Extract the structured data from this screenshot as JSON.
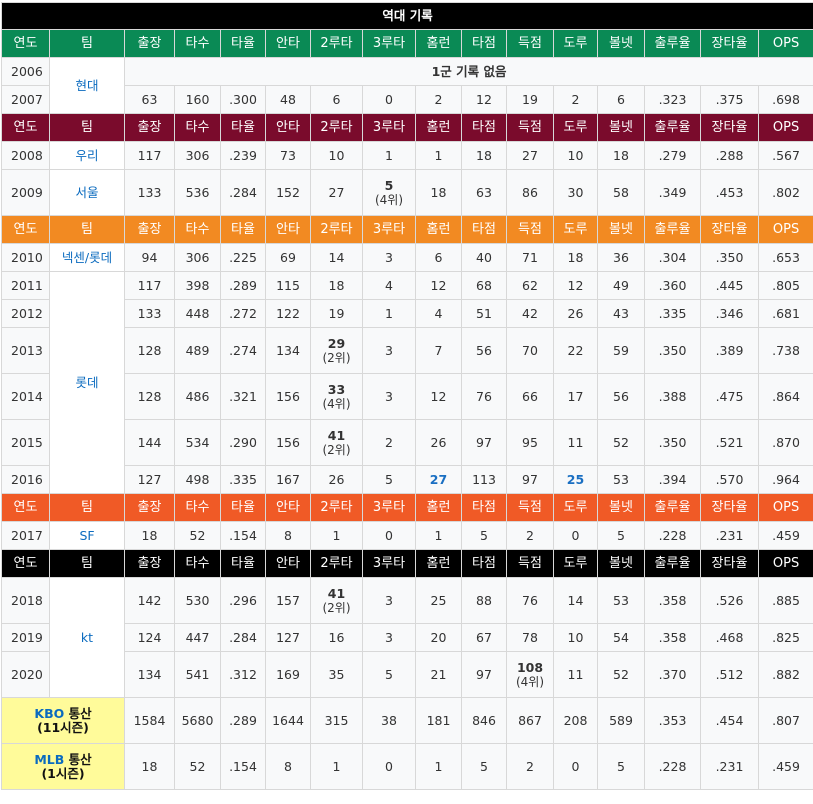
{
  "title": "역대 기록",
  "headers": [
    "연도",
    "팀",
    "출장",
    "타수",
    "타율",
    "안타",
    "2루타",
    "3루타",
    "홈런",
    "타점",
    "득점",
    "도루",
    "볼넷",
    "출루율",
    "장타율",
    "OPS"
  ],
  "no_record": "1군 기록 없음",
  "teams": {
    "hyundai": "현대",
    "woori": "우리",
    "seoul": "서울",
    "nexen_lotte": "넥센/롯데",
    "lotte": "롯데",
    "sf": "SF",
    "kt": "kt"
  },
  "rows": [
    {
      "year": "2006"
    },
    {
      "year": "2007",
      "v": [
        "63",
        "160",
        ".300",
        "48",
        "6",
        "0",
        "2",
        "12",
        "19",
        "2",
        "6",
        ".323",
        ".375",
        ".698"
      ]
    },
    {
      "year": "2008",
      "v": [
        "117",
        "306",
        ".239",
        "73",
        "10",
        "1",
        "1",
        "18",
        "27",
        "10",
        "18",
        ".279",
        ".288",
        ".567"
      ]
    },
    {
      "year": "2009",
      "v": [
        "133",
        "536",
        ".284",
        "152",
        "27",
        "5",
        "18",
        "63",
        "86",
        "30",
        "58",
        ".349",
        ".453",
        ".802"
      ],
      "rank": "(4위)"
    },
    {
      "year": "2010",
      "v": [
        "94",
        "306",
        ".225",
        "69",
        "14",
        "3",
        "6",
        "40",
        "71",
        "18",
        "36",
        ".304",
        ".350",
        ".653"
      ]
    },
    {
      "year": "2011",
      "v": [
        "117",
        "398",
        ".289",
        "115",
        "18",
        "4",
        "12",
        "68",
        "62",
        "12",
        "49",
        ".360",
        ".445",
        ".805"
      ]
    },
    {
      "year": "2012",
      "v": [
        "133",
        "448",
        ".272",
        "122",
        "19",
        "1",
        "4",
        "51",
        "42",
        "26",
        "43",
        ".335",
        ".346",
        ".681"
      ]
    },
    {
      "year": "2013",
      "v": [
        "128",
        "489",
        ".274",
        "134",
        "29",
        "3",
        "7",
        "56",
        "70",
        "22",
        "59",
        ".350",
        ".389",
        ".738"
      ],
      "rank": "(2위)"
    },
    {
      "year": "2014",
      "v": [
        "128",
        "486",
        ".321",
        "156",
        "33",
        "3",
        "12",
        "76",
        "66",
        "17",
        "56",
        ".388",
        ".475",
        ".864"
      ],
      "rank": "(4위)"
    },
    {
      "year": "2015",
      "v": [
        "144",
        "534",
        ".290",
        "156",
        "41",
        "2",
        "26",
        "97",
        "95",
        "11",
        "52",
        ".350",
        ".521",
        ".870"
      ],
      "rank": "(2위)"
    },
    {
      "year": "2016",
      "v": [
        "127",
        "498",
        ".335",
        "167",
        "26",
        "5",
        "27",
        "113",
        "97",
        "25",
        "53",
        ".394",
        ".570",
        ".964"
      ]
    },
    {
      "year": "2017",
      "v": [
        "18",
        "52",
        ".154",
        "8",
        "1",
        "0",
        "1",
        "5",
        "2",
        "0",
        "5",
        ".228",
        ".231",
        ".459"
      ]
    },
    {
      "year": "2018",
      "v": [
        "142",
        "530",
        ".296",
        "157",
        "41",
        "3",
        "25",
        "88",
        "76",
        "14",
        "53",
        ".358",
        ".526",
        ".885"
      ],
      "rank": "(2위)"
    },
    {
      "year": "2019",
      "v": [
        "124",
        "447",
        ".284",
        "127",
        "16",
        "3",
        "20",
        "67",
        "78",
        "10",
        "54",
        ".358",
        ".468",
        ".825"
      ]
    },
    {
      "year": "2020",
      "v": [
        "134",
        "541",
        ".312",
        "169",
        "35",
        "5",
        "21",
        "97",
        "108",
        "11",
        "52",
        ".370",
        ".512",
        ".882"
      ],
      "rank": "(4위)"
    }
  ],
  "totals": [
    {
      "league": "KBO",
      "label": "통산",
      "seasons": "(11시즌)",
      "v": [
        "1584",
        "5680",
        ".289",
        "1644",
        "315",
        "38",
        "181",
        "846",
        "867",
        "208",
        "589",
        ".353",
        ".454",
        ".807"
      ]
    },
    {
      "league": "MLB",
      "label": "통산",
      "seasons": "(1시즌)",
      "v": [
        "18",
        "52",
        ".154",
        "8",
        "1",
        "0",
        "1",
        "5",
        "2",
        "0",
        "5",
        ".228",
        ".231",
        ".459"
      ]
    }
  ],
  "colors": {
    "green": "#0a8a55",
    "maroon": "#7a0b2c",
    "orange": "#f28a22",
    "red": "#f05a26",
    "black": "#000000",
    "total_bg": "#fffb9a",
    "link": "#0b6bbf"
  }
}
